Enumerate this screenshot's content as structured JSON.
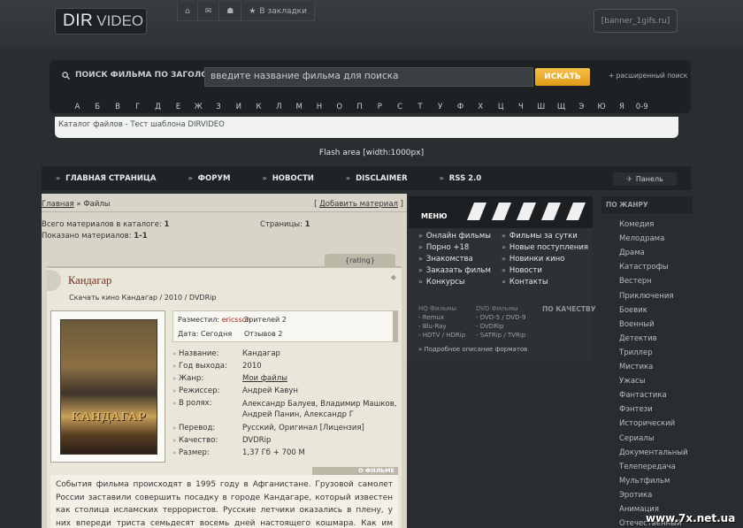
{
  "logo": {
    "part1": "DIR",
    "part2": "VIDEO"
  },
  "top_icons": {
    "home": "⌂",
    "mail": "✉",
    "users": "☗",
    "star": "★",
    "bookmark_label": "В закладки"
  },
  "banner": "[banner_1gifs.ru]",
  "search": {
    "label": "ПОИСК ФИЛЬМА ПО ЗАГОЛОВКУ",
    "value": "введите название фильма для поиска",
    "button": "ИСКАТЬ",
    "advanced": "+ расширенный поиск"
  },
  "letters": [
    "А",
    "Б",
    "В",
    "Г",
    "Д",
    "Е",
    "Ж",
    "З",
    "И",
    "К",
    "Л",
    "М",
    "Н",
    "О",
    "П",
    "Р",
    "С",
    "Т",
    "У",
    "Ф",
    "Х",
    "Ц",
    "Ч",
    "Ш",
    "Щ",
    "Э",
    "Ю",
    "Я",
    "0-9"
  ],
  "breadcrumb": "Каталог файлов - Тест шаблона DIRVIDEO",
  "flash": "Flash area [width:1000px]",
  "nav": {
    "items": [
      "ГЛАВНАЯ СТРАНИЦА",
      "ФОРУМ",
      "НОВОСТИ",
      "DISCLAIMER",
      "RSS 2.0"
    ],
    "panel": "Панель"
  },
  "main": {
    "bc_home": "Главная",
    "bc_sep": " » ",
    "bc_page": "Файлы",
    "add_material": "Добавить материал",
    "total_label": "Всего материалов в каталоге: ",
    "total_value": "1",
    "shown_label": "Показано материалов: ",
    "shown_value": "1-1",
    "pages_label": "Страницы: ",
    "pages_value": "1",
    "rating_tab": "{rating}"
  },
  "movie": {
    "title": "Кандагар",
    "subtitle": "Скачать кино Кандагар / 2010 / DVDRip",
    "poster_title": "КАНДАГАР",
    "posted_label": "Разместил:",
    "posted_by": "ericsson",
    "views_label": "Зрителей 2",
    "date_label": "Дата: Сегодня",
    "reviews_label": "Отзывов 2",
    "details": [
      {
        "k": "Название:",
        "v": "Кандагар"
      },
      {
        "k": "Год выхода:",
        "v": "2010"
      },
      {
        "k": "Жанр:",
        "v": "Мои файлы"
      },
      {
        "k": "Режиссер:",
        "v": "Андрей Кавун"
      },
      {
        "k": "В ролях:",
        "v": "Александр Балуев, Владимир Машков, Андрей Панин, Александр Г"
      },
      {
        "k": "Перевод:",
        "v": "Русский, Оригинал [Лицензия]"
      },
      {
        "k": "Качество:",
        "v": "DVDRip"
      },
      {
        "k": "Размер:",
        "v": "1,37 Гб + 700 М"
      }
    ],
    "about_label": "О ФИЛЬМЕ",
    "description": "События фильма происходят в 1995 году в Афганистане. Грузовой самолет России заставили совершить посадку в городе Кандагаре, который известен как столица исламских террористов. Русские летчики оказались в плену, у них впереди триста семьдесят восемь дней настоящего кошмара. Как им выстоять, не предать Россию, не"
  },
  "menu": {
    "title": "МЕНЮ",
    "left": [
      "Онлайн фильмы",
      "Порно +18",
      "Знакомства",
      "Заказать фильм",
      "Конкурсы"
    ],
    "right": [
      "Фильмы за сутки",
      "Новые поступления",
      "Новинки кино",
      "Новости",
      "Контакты"
    ],
    "hq_title": "HQ Фильмы",
    "hq": [
      "- Remux",
      "- Blu-Ray",
      "- HDTV / HDRip"
    ],
    "dvd_title": "DVD Фильмы",
    "dvd": [
      "- DVD-5 / DVD-9",
      "- DVDRip",
      "- SATRip / TVRip"
    ],
    "quality": "ПО КАЧЕСТВУ",
    "formats": "» Подробное описание форматов"
  },
  "genres": {
    "title": "ПО ЖАНРУ",
    "items": [
      "Комедия",
      "Мелодрама",
      "Драма",
      "Катастрофы",
      "Вестерн",
      "Приключения",
      "Боевик",
      "Военный",
      "Детектив",
      "Триллер",
      "Мистика",
      "Ужасы",
      "Фантастика",
      "Фэнтези",
      "Исторический",
      "Сериалы",
      "Документальный",
      "Телепередача",
      "Мультфильм",
      "Эротика",
      "Анимация",
      "Отечественный"
    ]
  },
  "watermark": "www.7x.net.ua"
}
